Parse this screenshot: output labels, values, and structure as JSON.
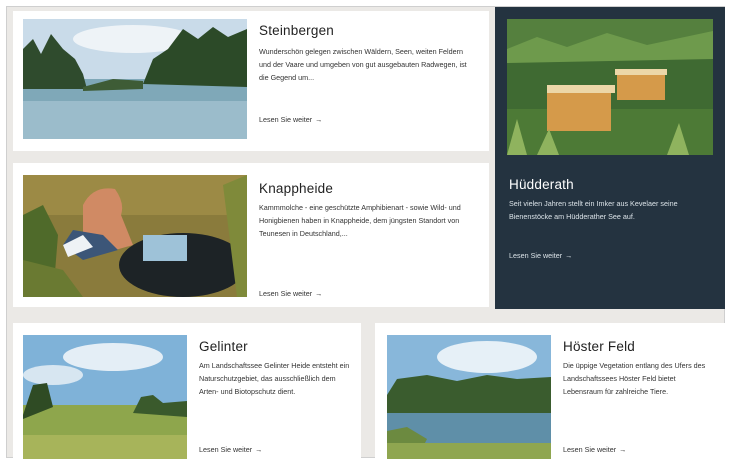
{
  "cards": [
    {
      "title": "Steinbergen",
      "text": "Wunderschön gelegen zwischen Wäldern, Seen, weiten Feldern und der Vaare und umgeben von gut ausgebauten Radwegen, ist die Gegend um...",
      "link": "Lesen Sie weiter",
      "arrow": "→",
      "image": "lake-forest-photo"
    },
    {
      "title": "Knappheide",
      "text": "Kammmolche - eine geschützte Amphibienart - sowie Wild- und Honigbienen haben in Knappheide, dem jüngsten Standort von Teunesen in Deutschland,...",
      "link": "Lesen Sie weiter",
      "arrow": "→",
      "image": "person-at-pond-photo"
    },
    {
      "title": "Hüdderath",
      "text": "Seit vielen Jahren stellt ein Imker aus Kevelaer seine Bienenstöcke am Hüdderather See auf.",
      "link": "Lesen Sie weiter",
      "arrow": "→",
      "image": "beehives-photo"
    },
    {
      "title": "Gelinter",
      "text": "Am Landschaftssee Gelinter Heide entsteht ein Naturschutzgebiet, das ausschließlich dem Arten- und Biotopschutz dient.",
      "link": "Lesen Sie weiter",
      "arrow": "→",
      "image": "meadow-photo"
    },
    {
      "title": "Höster Feld",
      "text": "Die üppige Vegetation entlang des Ufers des Landschaftssees Höster Feld bietet Lebensraum für zahlreiche Tiere.",
      "link": "Lesen Sie weiter",
      "arrow": "→",
      "image": "lakeshore-photo"
    }
  ],
  "colors": {
    "background": "#ebe9e6",
    "card": "#ffffff",
    "featured": "#243340"
  }
}
